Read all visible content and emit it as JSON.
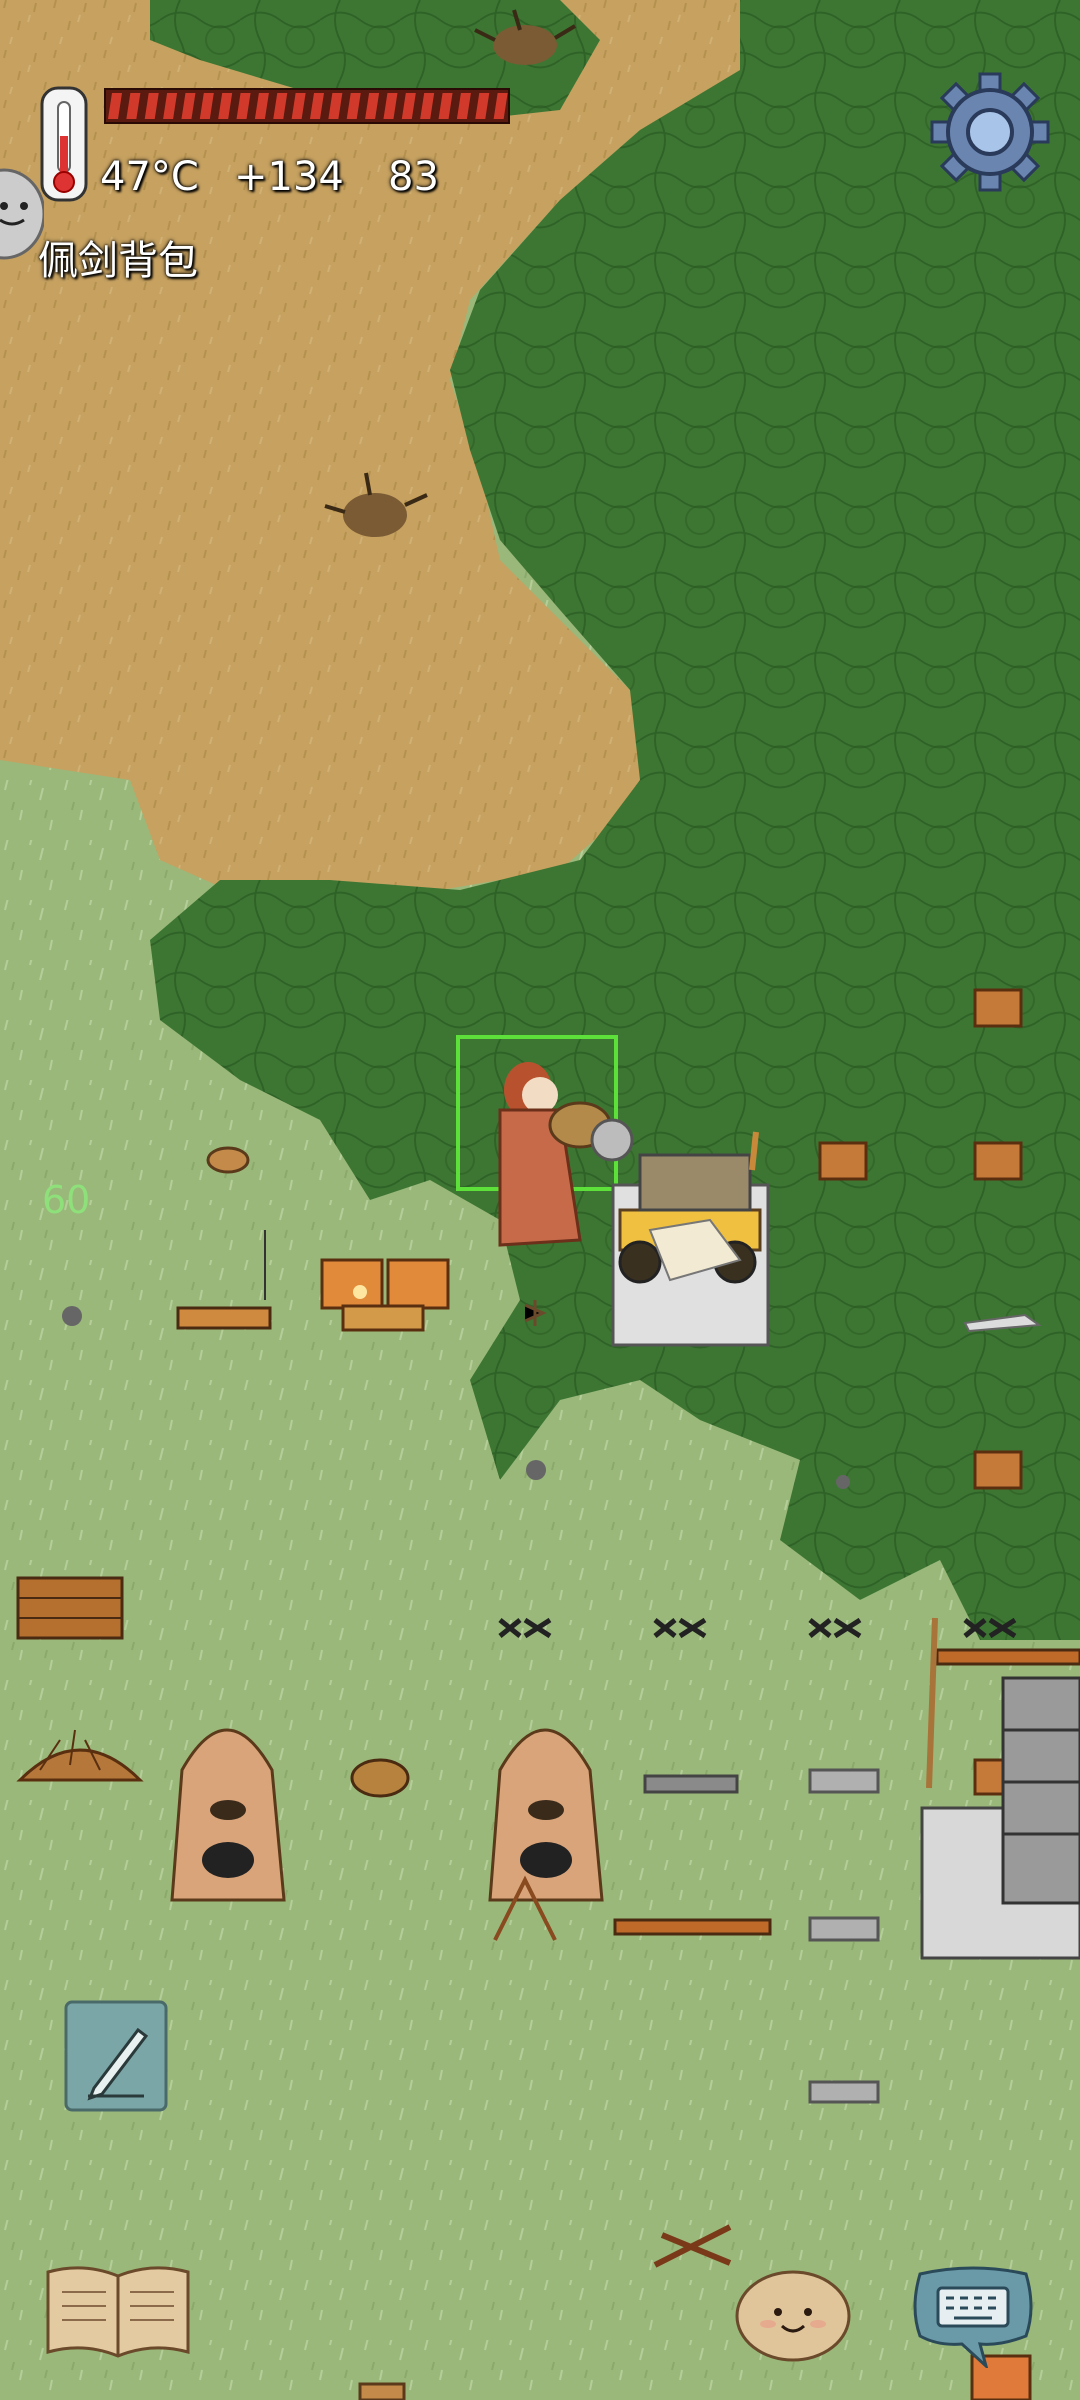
{
  "hud": {
    "temperature": "47°C",
    "yum_bonus": "+134",
    "age": "83",
    "held_item": "佩剑背包",
    "health_fraction": 1.0,
    "floating_number": "60"
  },
  "icons": {
    "thermometer": "thermometer-icon",
    "settings": "gear-icon",
    "note": "pencil-note-icon",
    "recipe_book": "open-book-icon",
    "emote": "smiley-potato-icon",
    "chat": "keyboard-speech-bubble-icon"
  },
  "colors": {
    "health_bar": "#d13a2a",
    "selection_box": "#5de03a",
    "floating_number": "#8ee07a",
    "dirt": "#c9a25e",
    "forest": "#3f7a35",
    "grass": "#98b878"
  }
}
